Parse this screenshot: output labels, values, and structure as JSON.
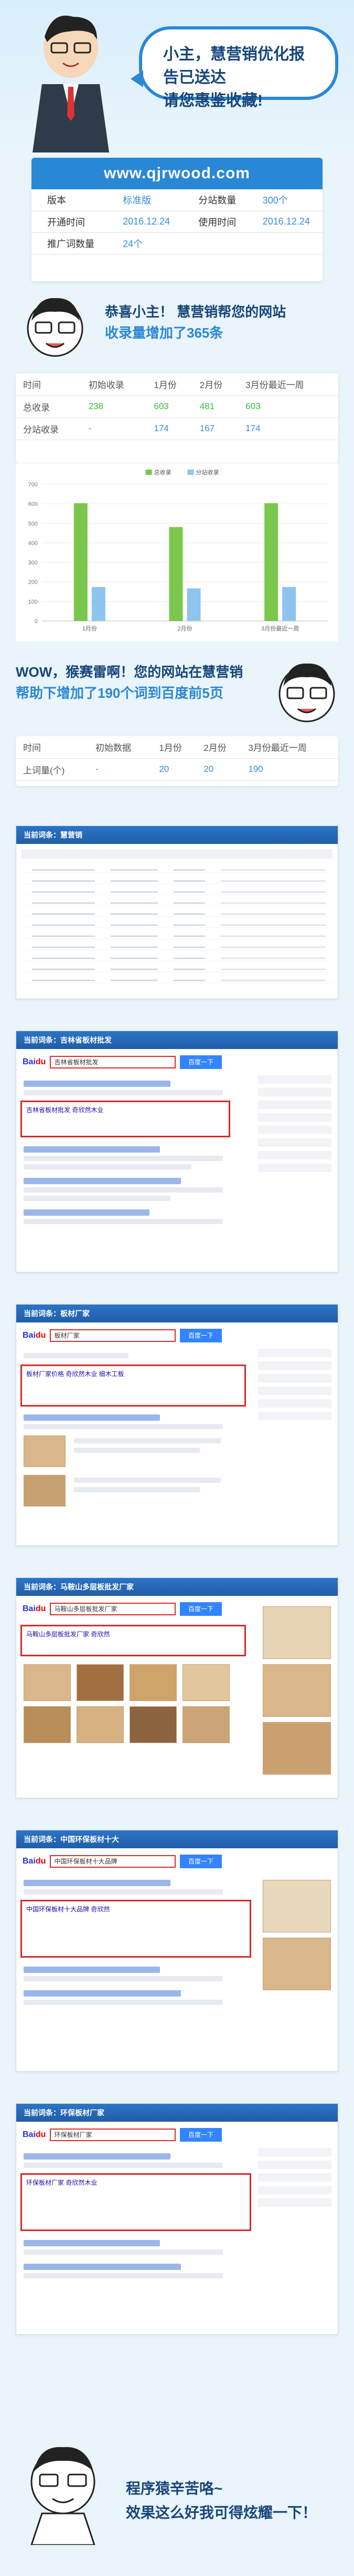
{
  "hero": {
    "bubble_line1": "小主，慧营销优化报告已送达",
    "bubble_line2": "请您惠鉴收藏!"
  },
  "site": {
    "url": "www.qjrwood.com",
    "rows": [
      {
        "k1": "版本",
        "v1": "标准版",
        "k2": "分站数量",
        "v2": "300个"
      },
      {
        "k1": "开通时间",
        "v1": "2016.12.24",
        "k2": "使用时间",
        "v2": "2016.12.24"
      },
      {
        "k1": "推广词数量",
        "v1": "24个",
        "k2": "",
        "v2": ""
      }
    ]
  },
  "banner1": {
    "line1": "恭喜小主！ 慧营销帮您的网站",
    "line2": "收录量增加了365条"
  },
  "include_table": {
    "headers": [
      "时间",
      "初始收录",
      "1月份",
      "2月份",
      "3月份最近一周"
    ],
    "rows": [
      {
        "label": "总收录",
        "values": [
          "238",
          "603",
          "481",
          "603"
        ]
      },
      {
        "label": "分站收录",
        "values": [
          "-",
          "174",
          "167",
          "174"
        ]
      }
    ]
  },
  "chart_data": {
    "type": "bar",
    "categories": [
      "1月份",
      "2月份",
      "3月份最近一周"
    ],
    "series": [
      {
        "name": "总收录",
        "values": [
          603,
          481,
          603
        ],
        "color": "#7bc74d"
      },
      {
        "name": "分站收录",
        "values": [
          174,
          167,
          174
        ],
        "color": "#8fc4ee"
      }
    ],
    "ylim": [
      0,
      700
    ],
    "yticks": [
      0,
      100,
      200,
      300,
      400,
      500,
      600,
      700
    ],
    "legend": "top-center",
    "grid": true
  },
  "banner2": {
    "line1": "WOW，猴赛雷啊！您的网站在慧营销",
    "line2": "帮助下增加了190个词到百度前5页"
  },
  "rank_table": {
    "headers": [
      "时间",
      "初始数据",
      "1月份",
      "2月份",
      "3月份最近一周"
    ],
    "row": {
      "label": "上词量(个)",
      "values": [
        "-",
        "20",
        "20",
        "190"
      ]
    }
  },
  "screens": [
    {
      "title": "当前词条：慧营销"
    },
    {
      "title": "当前词条：吉林省板材批发",
      "query": "吉林省板材批发",
      "button": "百度一下",
      "hit": "吉林省板材批发 奇欣然木业"
    },
    {
      "title": "当前词条：板材厂家",
      "query": "板材厂家",
      "button": "百度一下",
      "hit": "板材厂家价格 奇欣然木业 细木工板"
    },
    {
      "title": "当前词条：马鞍山多层板批发厂家",
      "query": "马鞍山多层板批发厂家",
      "button": "百度一下",
      "hit": "马鞍山多层板批发厂家 奇欣然"
    },
    {
      "title": "当前词条：中国环保板材十大",
      "query": "中国环保板材十大品牌",
      "button": "百度一下",
      "hit": "中国环保板材十大品牌 奇欣然"
    },
    {
      "title": "当前词条：环保板材厂家",
      "query": "环保板材厂家",
      "button": "百度一下",
      "hit": "环保板材厂家 奇欣然木业"
    }
  ],
  "footer": {
    "line1": "程序猿辛苦咯~",
    "line2": "效果这么好我可得炫耀一下！"
  }
}
